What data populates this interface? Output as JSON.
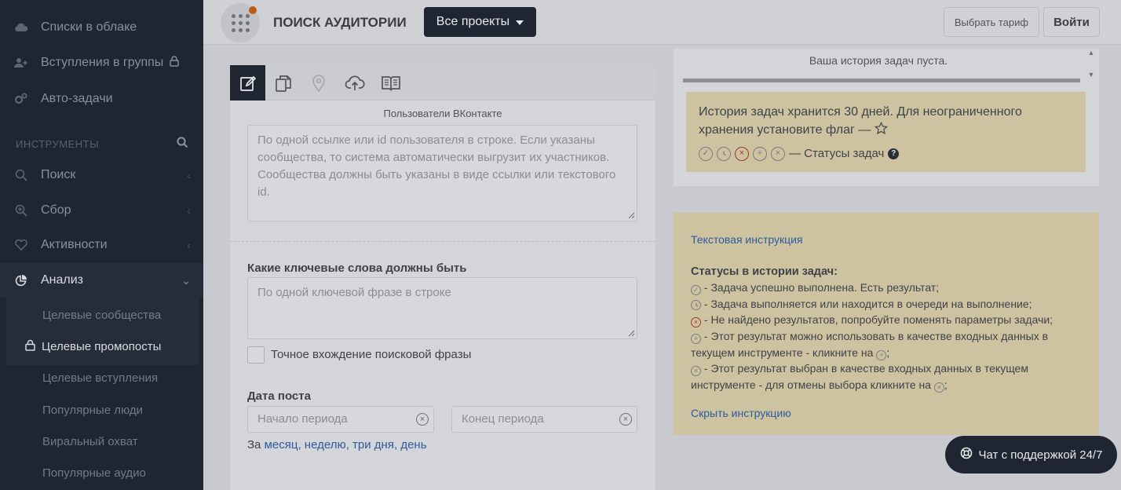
{
  "sidebar": {
    "top_items": [
      {
        "label": "Списки в облаке",
        "icon": "cloud-upload-icon"
      },
      {
        "label": "Вступления в группы",
        "icon": "user-plus-icon",
        "locked": true
      },
      {
        "label": "Авто-задачи",
        "icon": "gears-icon"
      }
    ],
    "section_title": "ИНСТРУМЕНТЫ",
    "tools": [
      {
        "label": "Поиск",
        "icon": "search-icon"
      },
      {
        "label": "Сбор",
        "icon": "zoom-plus-icon"
      },
      {
        "label": "Активности",
        "icon": "heart-icon"
      },
      {
        "label": "Анализ",
        "icon": "pie-chart-icon"
      }
    ],
    "sub_items": [
      {
        "label": "Целевые сообщества"
      },
      {
        "label": "Целевые промопосты",
        "locked": true
      },
      {
        "label": "Целевые вступления"
      },
      {
        "label": "Популярные люди"
      },
      {
        "label": "Виральный охват"
      },
      {
        "label": "Популярные аудио"
      }
    ]
  },
  "header": {
    "title": "ПОИСК АУДИТОРИИ",
    "projects_button": "Все проекты",
    "tariff_button": "Выбрать тариф",
    "login_button": "Войти"
  },
  "form": {
    "tabs": [
      {
        "icon": "edit-icon",
        "active": true
      },
      {
        "icon": "copy-icon"
      },
      {
        "icon": "map-pin-icon"
      },
      {
        "icon": "cloud-upload-icon"
      },
      {
        "icon": "book-icon"
      }
    ],
    "section_caption": "Пользователи ВКонтакте",
    "users_placeholder": "По одной ссылке или id пользователя в строке. Если указаны сообщества, то система автоматически выгрузит их участников. Сообщества должны быть указаны в виде ссылки или текстового id.",
    "keywords_label": "Какие ключевые слова должны быть",
    "keywords_placeholder": "По одной ключевой фразе в строке",
    "exact_match_label": "Точное вхождение поисковой фразы",
    "date_label": "Дата поста",
    "start_placeholder": "Начало периода",
    "end_placeholder": "Конец периода",
    "period_prefix": "За",
    "period_links": [
      "месяц,",
      "неделю,",
      "три дня,",
      "день"
    ]
  },
  "history": {
    "empty_text": "Ваша история задач пуста.",
    "note_text": "История задач хранится 30 дней. Для неограниченного хранения установите флаг —",
    "statuses_text": "— Статусы задач"
  },
  "instructions": {
    "link": "Текстовая инструкция",
    "heading": "Статусы в истории задач:",
    "line1": "- Задача успешно выполнена. Есть результат;",
    "line2": "- Задача выполняется или находится в очереди на выполнение;",
    "line3": "- Не найдено результатов, попробуйте поменять параметры задачи;",
    "line4a": "- Этот результат можно использовать в качестве входных данных в текущем инструменте - кликните на",
    "line4b": ";",
    "line5a": "- Этот результат выбран в качестве входных данных в текущем инструменте - для отмены выбора кликните на",
    "line5b": ";",
    "hide_link": "Скрыть инструкцию"
  },
  "chat": {
    "label": "Чат с поддержкой 24/7"
  },
  "colors": {
    "sidebar_bg": "#1f2531",
    "accent_dark": "#1f2531",
    "note_bg": "#cdc3a1",
    "link": "#2f5a9e",
    "notification_dot": "#c05b14"
  }
}
